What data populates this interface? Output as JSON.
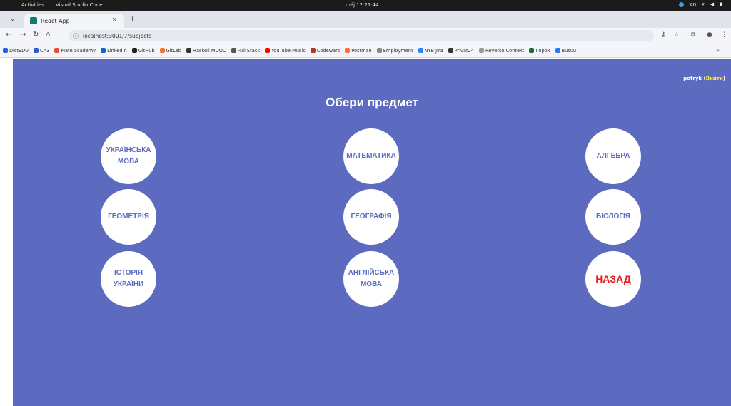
{
  "system_bar": {
    "activities": "Activities",
    "app_name": "Visual Studio Code",
    "clock": "máj 12  21:44",
    "lang": "en"
  },
  "browser": {
    "tab_title": "React App",
    "tab_close": "×",
    "new_tab": "+",
    "url": "localhost:3001/7/subjects",
    "bookmarks": [
      {
        "label": "DistEDU",
        "color": "#2a5bd7"
      },
      {
        "label": "CA3",
        "color": "#2a5bd7"
      },
      {
        "label": "Mate academy",
        "color": "#e84c3d"
      },
      {
        "label": "LinkedIn",
        "color": "#0a66c2"
      },
      {
        "label": "GitHub",
        "color": "#222222"
      },
      {
        "label": "GitLab",
        "color": "#fc6d26"
      },
      {
        "label": "Haskell MOOC",
        "color": "#333333"
      },
      {
        "label": "Full Stack",
        "color": "#555555"
      },
      {
        "label": "YouTube Music",
        "color": "#ff0000"
      },
      {
        "label": "Codewars",
        "color": "#b1361e"
      },
      {
        "label": "Postman",
        "color": "#ff6c37"
      },
      {
        "label": "Employment",
        "color": "#888888"
      },
      {
        "label": "NYB Jira",
        "color": "#2684ff"
      },
      {
        "label": "Privat24",
        "color": "#333333"
      },
      {
        "label": "Reverso Context",
        "color": "#999999"
      },
      {
        "label": "Горох",
        "color": "#1d6b3a"
      },
      {
        "label": "Busuu",
        "color": "#2979ff"
      }
    ],
    "bookmarks_more": "»"
  },
  "app": {
    "username": "potryk",
    "logout_label": "Вийти",
    "heading": "Обери предмет",
    "subjects": [
      "УКРАЇНСЬКА МОВА",
      "МАТЕМАТИКА",
      "АЛГЕБРА",
      "ГЕОМЕТРІЯ",
      "ГЕОГРАФІЯ",
      "БІОЛОГІЯ",
      "ІСТОРІЯ УКРАЇНИ",
      "АНГЛІЙСЬКА МОВА"
    ],
    "back_label": "НАЗАД"
  },
  "colors": {
    "background": "#5c6bc0",
    "circle": "#ffffff",
    "subject_text": "#5c6bc0",
    "back_text": "#e52020",
    "logout_link": "#ffeb3b"
  }
}
